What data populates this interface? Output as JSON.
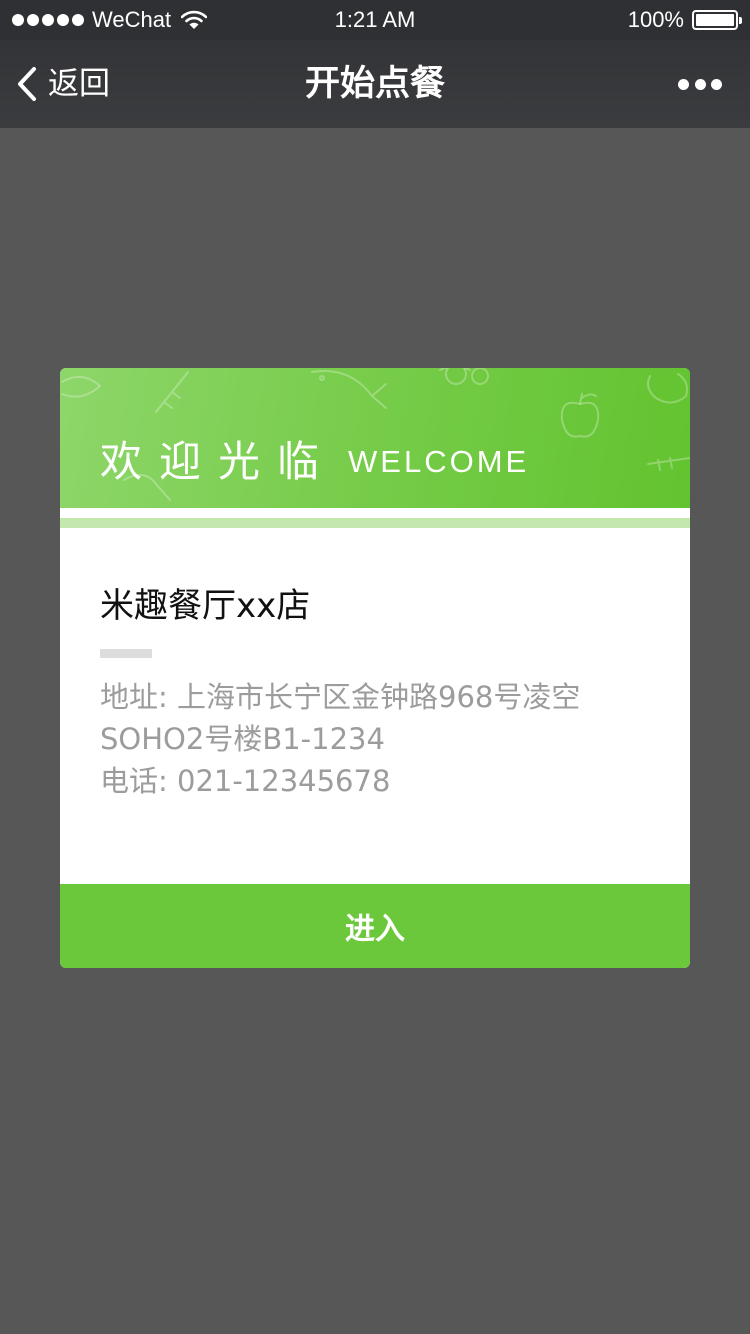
{
  "status_bar": {
    "carrier": "WeChat",
    "time": "1:21 AM",
    "battery": "100%"
  },
  "nav": {
    "back_label": "返回",
    "title": "开始点餐",
    "more_icon": "more-dots-icon"
  },
  "card": {
    "welcome_cn": "欢迎光临",
    "welcome_en": "WELCOME",
    "store_name": "米趣餐厅xx店",
    "address_line1": "地址: 上海市长宁区金钟路968号凌空",
    "address_line2": "SOHO2号楼B1-1234",
    "phone": "电话: 021-12345678",
    "enter_label": "进入"
  },
  "colors": {
    "page_background": "#575757",
    "nav_background": "#3b3c3f",
    "accent_green": "#6bc83b",
    "header_green_light": "#8ed66a",
    "stripe_green": "#c2e8ae",
    "info_text": "#9c9c9c"
  }
}
